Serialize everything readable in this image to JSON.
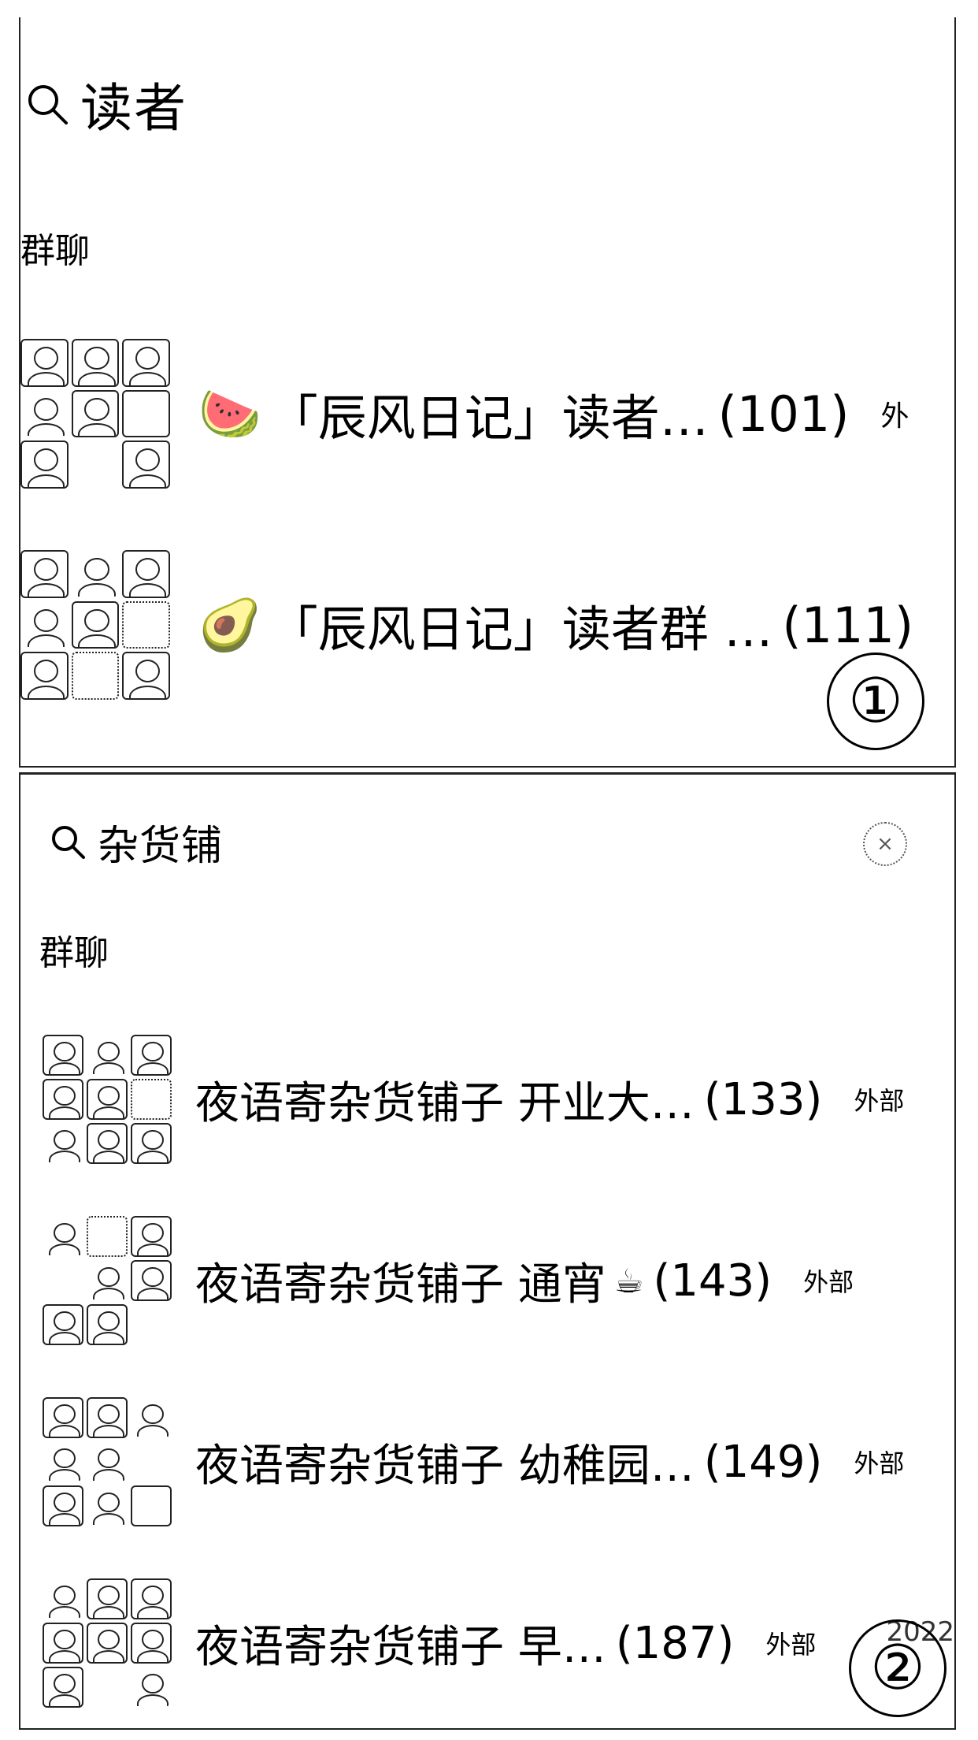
{
  "panel1": {
    "query": "读者",
    "section_label": "群聊",
    "badge": "①",
    "results": [
      {
        "emoji": "🍉",
        "name": "「辰风日记」读者…",
        "count": "(101)",
        "tag": "外"
      },
      {
        "emoji": "🥑",
        "name": "「辰风日记」读者群 …",
        "count": "(111)"
      }
    ]
  },
  "panel2": {
    "query": "杂货铺",
    "section_label": "群聊",
    "badge": "②",
    "results": [
      {
        "name": "夜语寄杂货铺子 开业大…",
        "count": "(133)",
        "tag": "外部"
      },
      {
        "name": "夜语寄杂货铺子 通宵",
        "emoji": "☕",
        "count": "(143)",
        "tag": "外部"
      },
      {
        "name": "夜语寄杂货铺子 幼稚园…",
        "count": "(149)",
        "tag": "外部"
      },
      {
        "name": "夜语寄杂货铺子 早…",
        "count": "(187)",
        "tag": "外部",
        "date": "2022"
      }
    ]
  },
  "icons": {
    "search": "search-icon",
    "clear": "clear-icon"
  }
}
